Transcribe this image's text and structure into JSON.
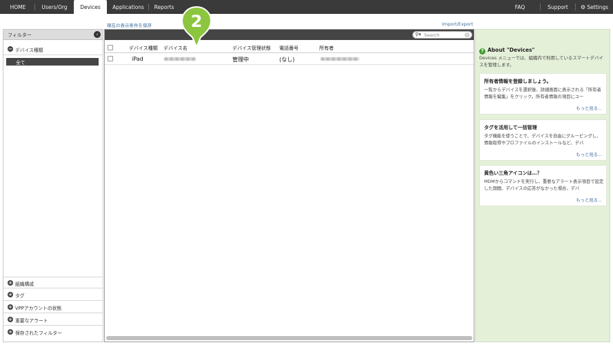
{
  "nav": {
    "home": "HOME",
    "users_org": "Users/Org",
    "devices": "Devices",
    "applications": "Applications",
    "reports": "Reports",
    "faq": "FAQ",
    "support": "Support",
    "settings": "Settings"
  },
  "sub_links": {
    "save_filter": "現在の表示条件を保存",
    "import_export": "Import/Export"
  },
  "sidebar": {
    "header": "フィルター",
    "device_type_section": "デバイス種類",
    "device_type_selected": "全て",
    "sections": [
      "組織構成",
      "タグ",
      "VPPアカウントの状態",
      "重要なアラート",
      "保存されたフィルター"
    ]
  },
  "search": {
    "placeholder": "Search"
  },
  "table": {
    "headers": [
      "デバイス種類",
      "デバイス名",
      "デバイス管理状態",
      "電話番号",
      "所有者"
    ],
    "rows": [
      {
        "device_type": "iPad",
        "device_status": "管理中",
        "phone": "(なし)"
      }
    ]
  },
  "marker": {
    "label": "2",
    "color": "#8cc63f"
  },
  "info": {
    "title": "About \"Devices\"",
    "description": "Devices メニューでは、組織内で利用しているスマートデバイスを管理します。",
    "cards": [
      {
        "title": "所有者情報を登録しましょう。",
        "body": "一覧からデバイスを選択後、詳細画面に表示される「所有者情報を編集」をクリック。所有者情報の項目にユー",
        "more": "もっと見る..."
      },
      {
        "title": "タグを活用して一括管理",
        "body": "タグ機能を使うことで、デバイスを自由にグルーピングし、情報取得やプロファイルのインストールなど、デバ",
        "more": "もっと見る..."
      },
      {
        "title": "黄色い三角アイコンは…？",
        "body": "MDMからコマンドを実行し、重要なアラート表示項目で設定した期間、デバイスの応答がなかった場合、デバ",
        "more": "もっと見る..."
      }
    ]
  },
  "colors": {
    "topbar": "#3a3a3a",
    "accent_green": "#8cc63f",
    "info_bg": "#e5f0d9",
    "link": "#3c6e9c"
  }
}
